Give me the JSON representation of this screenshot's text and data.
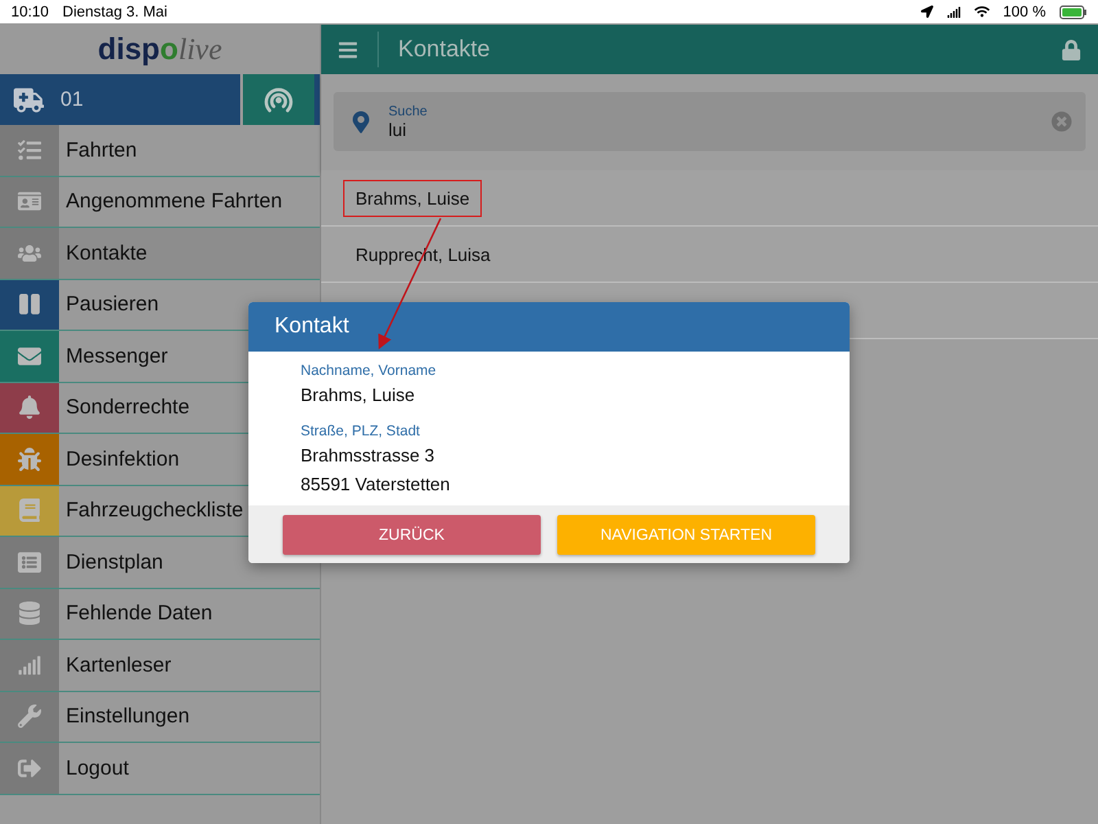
{
  "status_bar": {
    "time": "10:10",
    "date": "Dienstag 3. Mai",
    "battery": "100 %"
  },
  "logo": [
    {
      "text": "disp",
      "kind": "bold"
    },
    {
      "text": "o",
      "kind": "accent"
    },
    {
      "text": "live",
      "kind": "script"
    }
  ],
  "vehicle": {
    "number": "01"
  },
  "sidebar": {
    "items": [
      {
        "label": "Fahrten",
        "selected": false,
        "color": "#7a7a7a"
      },
      {
        "label": "Angenommene Fahrten",
        "selected": false,
        "color": "#7a7a7a"
      },
      {
        "label": "Kontakte",
        "selected": true,
        "color": "#7a7a7a"
      },
      {
        "label": "Pausieren",
        "selected": false,
        "color": "#1d4670"
      },
      {
        "label": "Messenger",
        "selected": false,
        "color": "#1a6f62"
      },
      {
        "label": "Sonderrechte",
        "selected": false,
        "color": "#8e3d4a"
      },
      {
        "label": "Desinfektion",
        "selected": false,
        "color": "#a86200"
      },
      {
        "label": "Fahrzeugcheckliste",
        "selected": false,
        "color": "#b89a3a"
      },
      {
        "label": "Dienstplan",
        "selected": false,
        "color": "#7a7a7a"
      },
      {
        "label": "Fehlende Daten",
        "selected": false,
        "color": "#7a7a7a"
      },
      {
        "label": "Kartenleser",
        "selected": false,
        "color": "#7a7a7a"
      },
      {
        "label": "Einstellungen",
        "selected": false,
        "color": "#7a7a7a"
      },
      {
        "label": "Logout",
        "selected": false,
        "color": "#7a7a7a"
      }
    ]
  },
  "header": {
    "title": "Kontakte"
  },
  "search": {
    "label": "Suche",
    "value": "lui"
  },
  "results": [
    {
      "name": "Brahms, Luise",
      "highlighted": true
    },
    {
      "name": "Rupprecht, Luisa",
      "highlighted": false
    }
  ],
  "dialog": {
    "title": "Kontakt",
    "fields": [
      {
        "label": "Nachname, Vorname",
        "lines": [
          "Brahms, Luise"
        ]
      },
      {
        "label": "Straße, PLZ, Stadt",
        "lines": [
          "Brahmsstrasse 3",
          "85591 Vaterstetten"
        ]
      }
    ],
    "buttons": [
      {
        "label": "ZURÜCK",
        "kind": "back"
      },
      {
        "label": "NAVIGATION STARTEN",
        "kind": "primary"
      }
    ]
  }
}
